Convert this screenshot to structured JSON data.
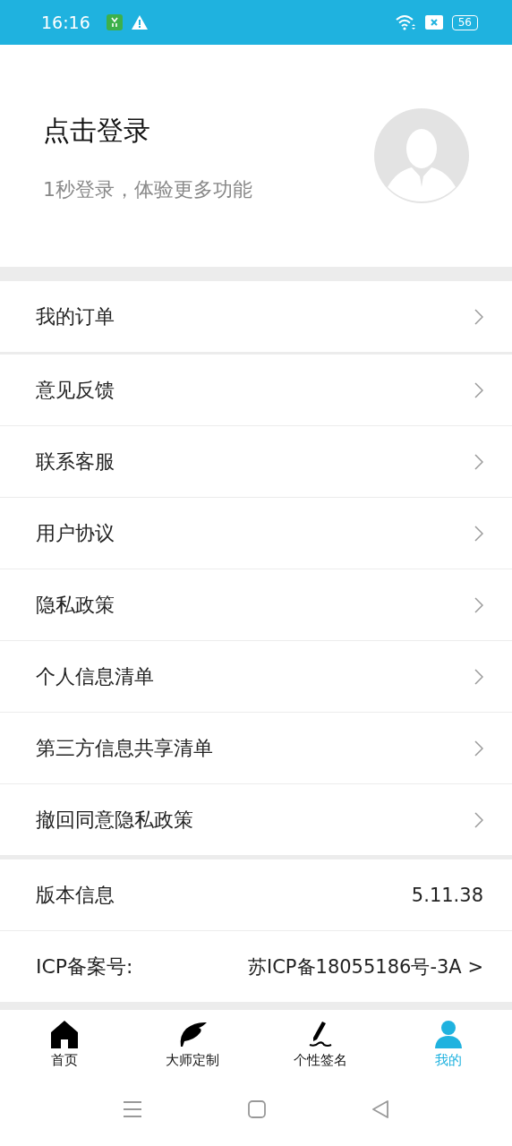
{
  "status_bar": {
    "time": "16:16",
    "battery": "56"
  },
  "profile": {
    "title": "点击登录",
    "subtitle": "1秒登录，体验更多功能"
  },
  "menu": [
    {
      "label": "我的订单"
    },
    {
      "label": "意见反馈"
    },
    {
      "label": "联系客服"
    },
    {
      "label": "用户协议"
    },
    {
      "label": "隐私政策"
    },
    {
      "label": "个人信息清单"
    },
    {
      "label": "第三方信息共享清单"
    },
    {
      "label": "撤回同意隐私政策"
    }
  ],
  "info": [
    {
      "label": "版本信息",
      "value": "5.11.38"
    },
    {
      "label": "ICP备案号:",
      "value": "苏ICP备18055186号-3A >"
    }
  ],
  "tabs": [
    {
      "label": "首页",
      "kind": "home",
      "selected": false
    },
    {
      "label": "大师定制",
      "kind": "feather",
      "selected": false
    },
    {
      "label": "个性签名",
      "kind": "pen",
      "selected": false
    },
    {
      "label": "我的",
      "kind": "person",
      "selected": true
    }
  ]
}
